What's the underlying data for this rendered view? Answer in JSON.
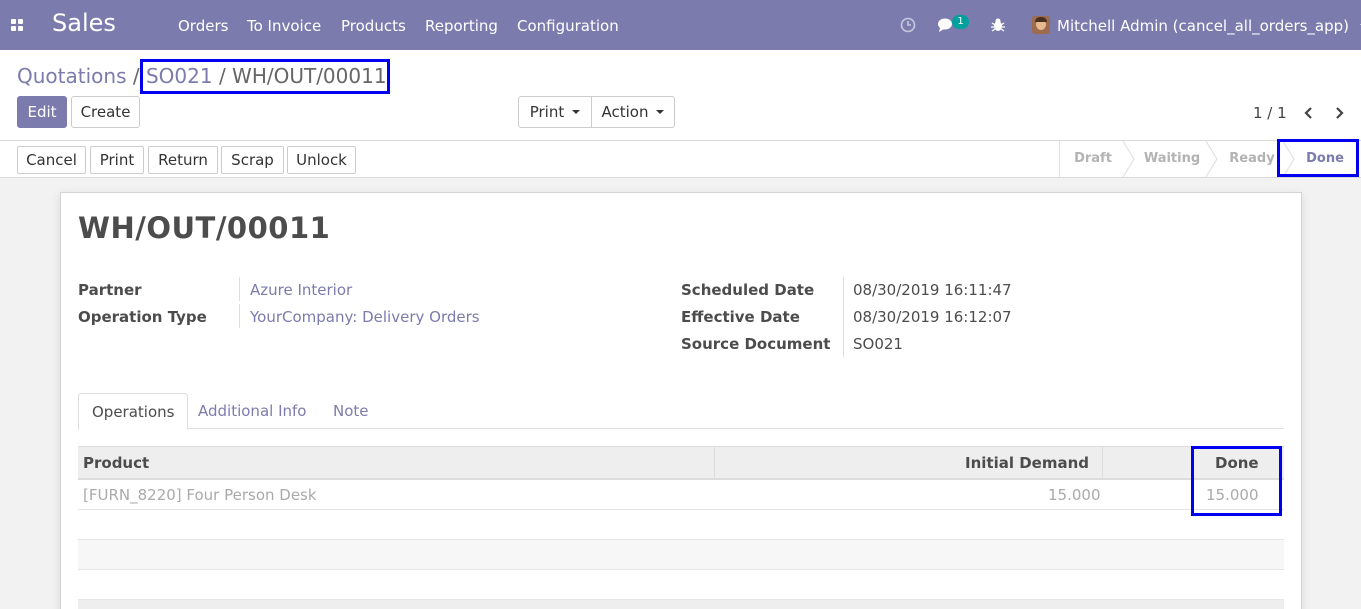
{
  "navbar": {
    "brand": "Sales",
    "menu": [
      "Orders",
      "To Invoice",
      "Products",
      "Reporting",
      "Configuration"
    ],
    "messages_badge": "1",
    "user": "Mitchell Admin (cancel_all_orders_app)",
    "bg_color": "#7c7bad"
  },
  "breadcrumb": {
    "root": "Quotations",
    "sep": "/",
    "parent": "SO021",
    "current": "WH/OUT/00011"
  },
  "toolbar": {
    "edit": "Edit",
    "create": "Create",
    "print": "Print",
    "action": "Action",
    "pager": "1 / 1"
  },
  "statusbar": {
    "buttons": [
      "Cancel",
      "Print",
      "Return",
      "Scrap",
      "Unlock"
    ],
    "stages": [
      "Draft",
      "Waiting",
      "Ready",
      "Done"
    ],
    "active_stage": "Done"
  },
  "record": {
    "name": "WH/OUT/00011",
    "fields": {
      "partner_label": "Partner",
      "partner_value": "Azure Interior",
      "operation_type_label": "Operation Type",
      "operation_type_value": "YourCompany: Delivery Orders",
      "scheduled_date_label": "Scheduled Date",
      "scheduled_date_value": "08/30/2019 16:11:47",
      "effective_date_label": "Effective Date",
      "effective_date_value": "08/30/2019 16:12:07",
      "source_document_label": "Source Document",
      "source_document_value": "SO021"
    },
    "tabs": [
      "Operations",
      "Additional Info",
      "Note"
    ],
    "table": {
      "headers": [
        "Product",
        "Initial Demand",
        "Done"
      ],
      "rows": [
        {
          "product": "[FURN_8220] Four Person Desk",
          "initial_demand": "15.000",
          "done": "15.000"
        }
      ]
    }
  },
  "highlight_color": "#0000ee"
}
